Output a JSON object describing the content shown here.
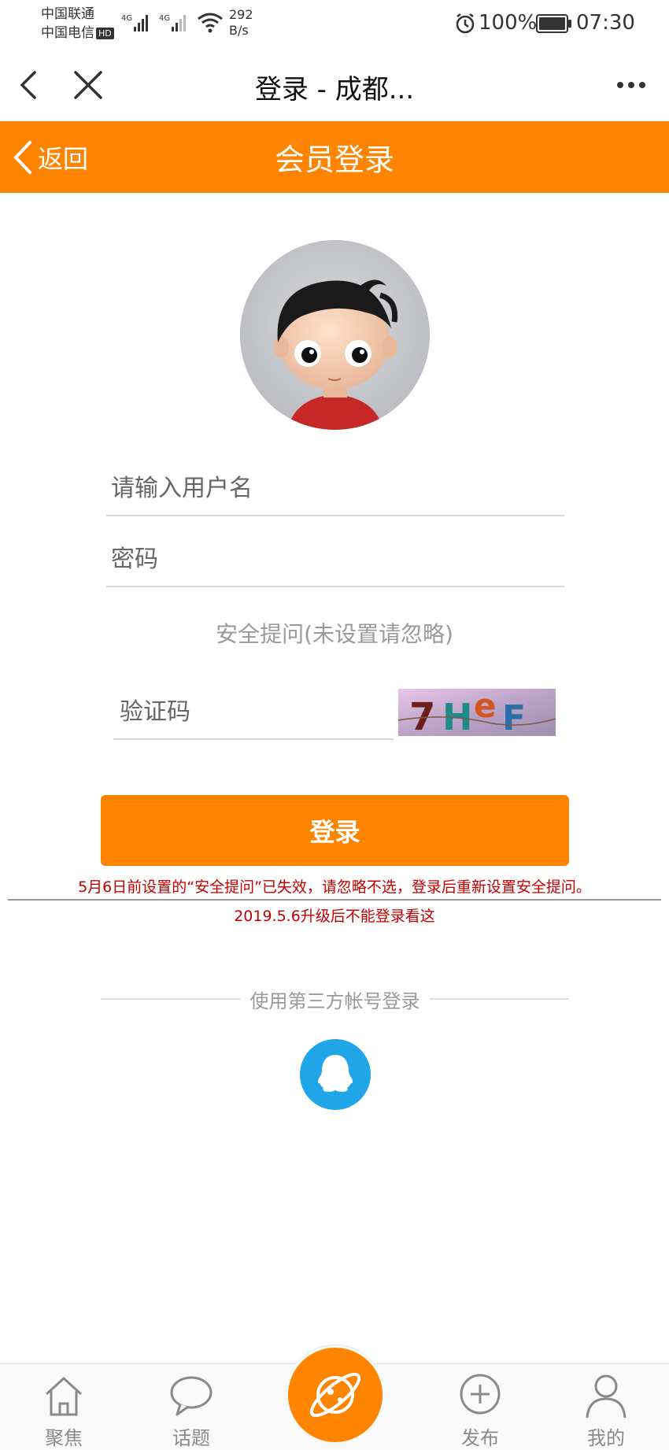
{
  "status_bar": {
    "carrier_1": "中国联通",
    "carrier_2": "中国电信",
    "hd_badge": "HD",
    "network_1": "4G",
    "network_2": "4G",
    "net_speed_value": "292",
    "net_speed_unit": "B/s",
    "battery": "100%",
    "time": "07:30"
  },
  "webview_bar": {
    "title": "登录 - 成都..."
  },
  "header": {
    "back_label": "返回",
    "title": "会员登录"
  },
  "form": {
    "username_placeholder": "请输入用户名",
    "password_placeholder": "密码",
    "security_question": "安全提问(未设置请忽略)",
    "captcha_placeholder": "验证码",
    "captcha_text": "7HeF",
    "login_button": "登录"
  },
  "notices": {
    "line1": "5月6日前设置的“安全提问”已失效，请忽略不选，登录后重新设置安全提问。",
    "line2": "2019.5.6升级后不能登录看这"
  },
  "third_party": {
    "label": "使用第三方帐号登录"
  },
  "tabbar": {
    "items": [
      {
        "label": "聚焦",
        "icon": "home-icon"
      },
      {
        "label": "话题",
        "icon": "chat-bubble-icon"
      },
      {
        "label": "",
        "icon": "planet-icon"
      },
      {
        "label": "发布",
        "icon": "plus-circle-icon"
      },
      {
        "label": "我的",
        "icon": "user-icon"
      }
    ]
  },
  "colors": {
    "accent": "#ff8400",
    "notice": "#c40000",
    "qq": "#1fa5e8"
  }
}
